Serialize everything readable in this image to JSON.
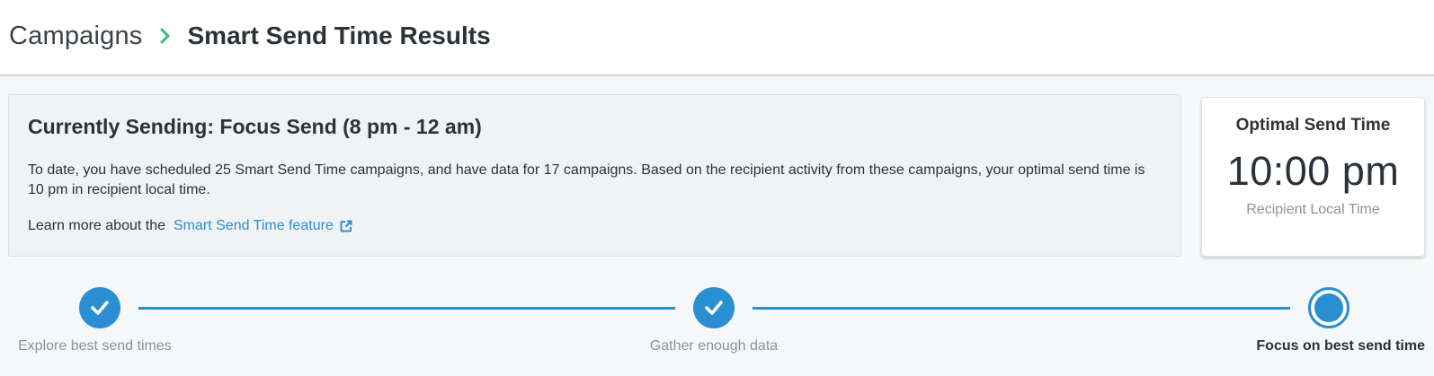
{
  "breadcrumb": {
    "parent": "Campaigns",
    "current": "Smart Send Time Results"
  },
  "info": {
    "title": "Currently Sending: Focus Send (8 pm - 12 am)",
    "description": "To date, you have scheduled 25 Smart Send Time campaigns, and have data for 17 campaigns. Based on the recipient activity from these campaigns, your optimal send time is 10 pm in recipient local time.",
    "learn_prefix": "Learn more about the",
    "learn_link": "Smart Send Time feature"
  },
  "optimal": {
    "label": "Optimal Send Time",
    "time": "10:00 pm",
    "sub": "Recipient Local Time"
  },
  "steps": [
    {
      "label": "Explore best send times",
      "state": "done"
    },
    {
      "label": "Gather enough data",
      "state": "done"
    },
    {
      "label": "Focus on best send time",
      "state": "current"
    }
  ],
  "colors": {
    "accent": "#2a8fd2",
    "chevron": "#3cb878",
    "muted": "#8c9397",
    "text": "#2b3338"
  },
  "icons": {
    "chevron": "chevron-right-icon",
    "external": "external-link-icon",
    "check": "check-icon"
  }
}
